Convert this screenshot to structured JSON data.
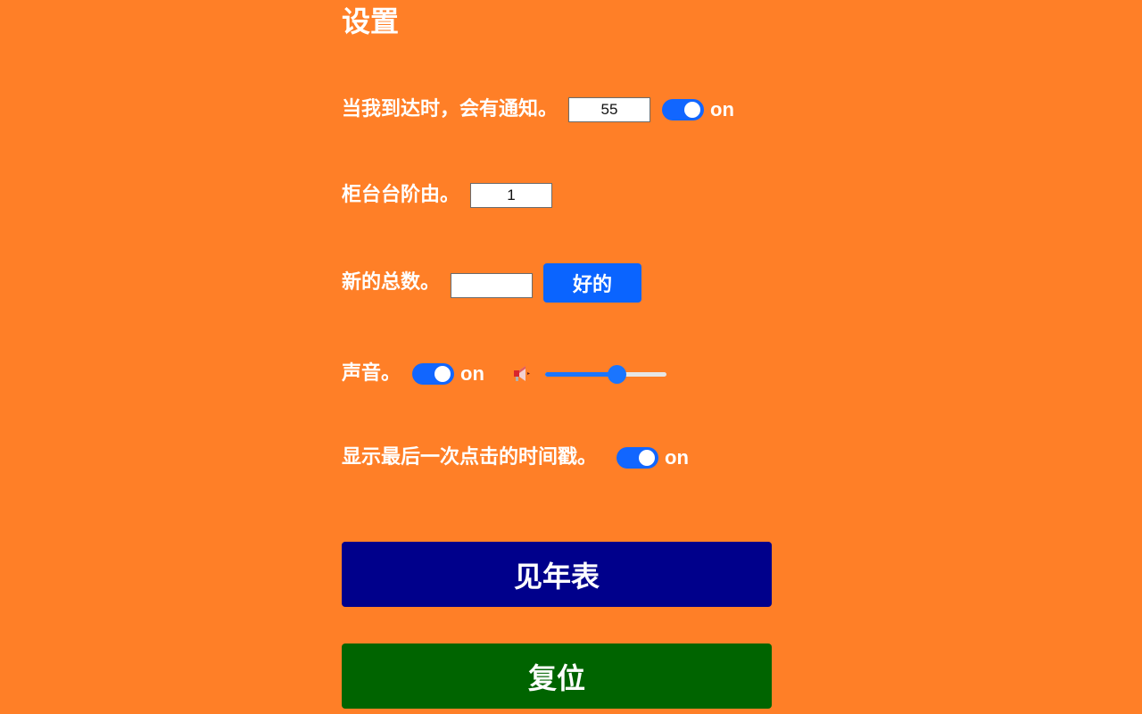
{
  "settings": {
    "title": "设置",
    "notify": {
      "label": "当我到达时，会有通知。",
      "value": "55",
      "toggle_state": "on"
    },
    "counter": {
      "label": "柜台台阶由。",
      "value": "1"
    },
    "new_total": {
      "label": "新的总数。",
      "value": "",
      "ok_label": "好的"
    },
    "sound": {
      "label": "声音。",
      "toggle_state": "on",
      "volume": 0.6
    },
    "timestamp": {
      "label": "显示最后一次点击的时间戳。",
      "toggle_state": "on"
    },
    "actions": {
      "year_table_label": "见年表",
      "reset_label": "复位"
    }
  },
  "icons": {
    "speaker": "speaker-icon"
  },
  "colors": {
    "background": "#FF7F27",
    "toggle_on": "#1166FF",
    "ok_button": "#0A64FF",
    "year_table_button": "#00008B",
    "reset_button": "#006400"
  }
}
